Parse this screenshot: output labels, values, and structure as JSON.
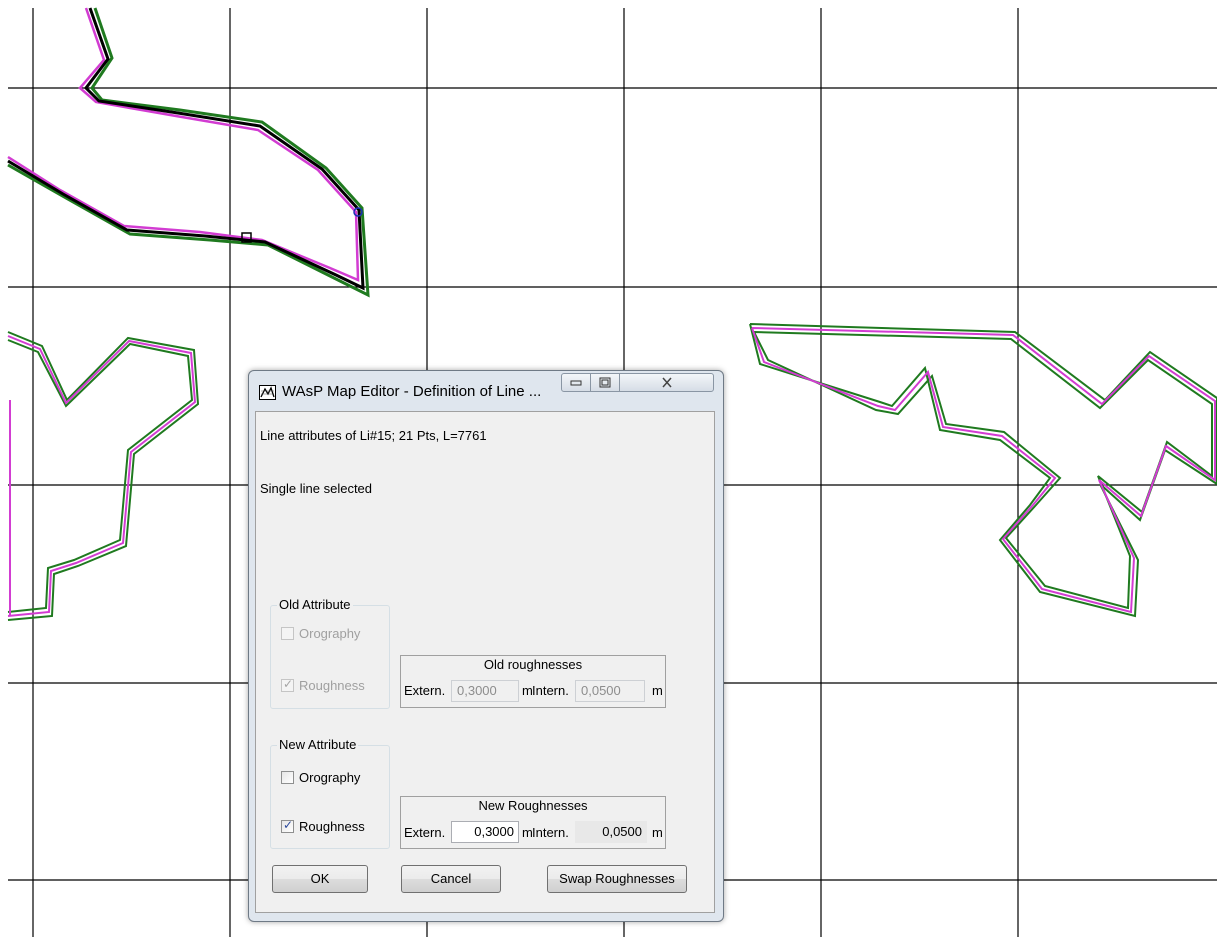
{
  "window": {
    "title": "WAsP Map Editor - Definition of Line ...",
    "minimize_icon": "minimize-icon",
    "maximize_icon": "maximize-icon",
    "close_icon": "close-icon",
    "app_icon": "wasp-map-icon"
  },
  "info": {
    "line_attributes": "Line attributes of Li#15; 21 Pts, L=7761",
    "selection_status": "Single line selected"
  },
  "old_attribute": {
    "group_label": "Old Attribute",
    "orography_label": "Orography",
    "orography_checked": false,
    "roughness_label": "Roughness",
    "roughness_checked": true,
    "roughness_box_title": "Old roughnesses",
    "extern_label": "Extern.",
    "extern_value": "0,3000",
    "extern_unit": "m",
    "intern_label": "Intern.",
    "intern_value": "0,0500",
    "intern_unit": "m"
  },
  "new_attribute": {
    "group_label": "New Attribute",
    "orography_label": "Orography",
    "orography_checked": false,
    "roughness_label": "Roughness",
    "roughness_checked": true,
    "roughness_box_title": "New Roughnesses",
    "extern_label": "Extern.",
    "extern_value": "0,3000",
    "extern_unit": "m",
    "intern_label": "Intern.",
    "intern_value": "0,0500",
    "intern_unit": "m"
  },
  "buttons": {
    "ok": "OK",
    "cancel": "Cancel",
    "swap": "Swap Roughnesses"
  },
  "colors": {
    "grid_line": "#000000",
    "line_outer": "#1f7a1f",
    "line_inner": "#d23cd2",
    "selected_line": "#000000"
  }
}
